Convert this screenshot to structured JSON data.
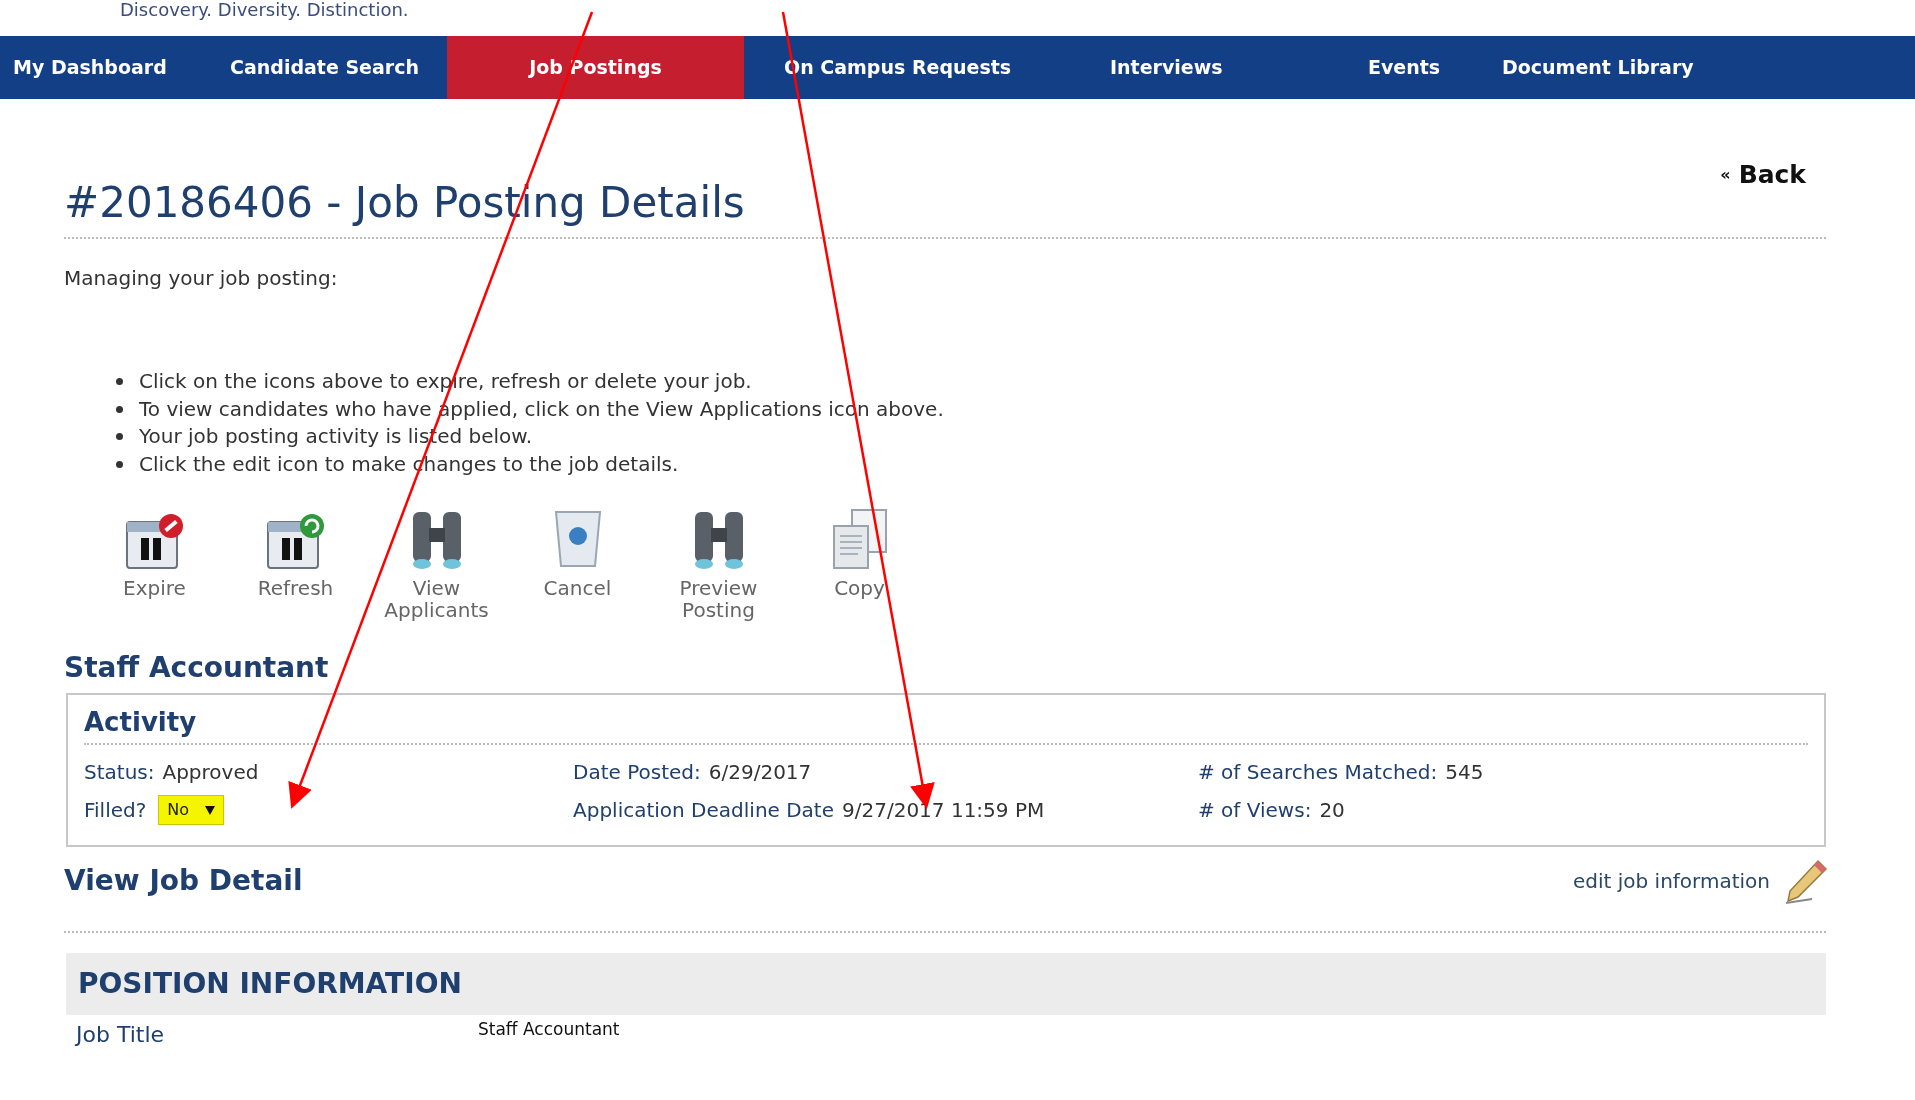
{
  "tagline": "Discovery. Diversity. Distinction.",
  "nav": [
    {
      "label": "My Dashboard",
      "selected": false
    },
    {
      "label": "Candidate Search",
      "selected": false
    },
    {
      "label": "Job Postings",
      "selected": true
    },
    {
      "label": "On Campus Requests",
      "selected": false
    },
    {
      "label": "Interviews",
      "selected": false
    },
    {
      "label": "Events",
      "selected": false
    },
    {
      "label": "Document Library",
      "selected": false
    }
  ],
  "back": {
    "mark": "«",
    "label": "Back"
  },
  "title": "#20186406 - Job Posting Details",
  "intro": "Managing your job posting:",
  "bullets": [
    "Click on the icons above to expire, refresh or delete your job.",
    "To view candidates who have applied, click on the View Applications icon above.",
    "Your job posting activity is listed below.",
    "Click the edit icon to make changes to the job details."
  ],
  "actions": [
    {
      "label": "Expire",
      "kind": "expire"
    },
    {
      "label": "Refresh",
      "kind": "refresh"
    },
    {
      "label": "View Applicants",
      "kind": "binoculars"
    },
    {
      "label": "Cancel",
      "kind": "bin"
    },
    {
      "label": "Preview Posting",
      "kind": "binoculars"
    },
    {
      "label": "Copy",
      "kind": "documents"
    }
  ],
  "job_name": "Staff Accountant",
  "activity": {
    "title": "Activity",
    "columns": [
      [
        {
          "kind": "text",
          "label": "Status:",
          "value": "Approved"
        },
        {
          "kind": "dropdown",
          "label": "Filled?",
          "value": "No"
        }
      ],
      [
        {
          "kind": "text",
          "label": "Date Posted:",
          "value": "6/29/2017"
        },
        {
          "kind": "text",
          "label": "Application Deadline Date",
          "value": "9/27/2017 11:59 PM"
        }
      ],
      [
        {
          "kind": "text",
          "label": "# of Searches Matched:",
          "value": "545"
        },
        {
          "kind": "text",
          "label": "# of Views:",
          "value": "20"
        }
      ]
    ]
  },
  "detail_title": "View Job Detail",
  "edit_link": "edit job information",
  "position": {
    "heading": "POSITION INFORMATION",
    "rows": [
      {
        "label": "Job Title",
        "value": "Staff Accountant"
      }
    ]
  }
}
